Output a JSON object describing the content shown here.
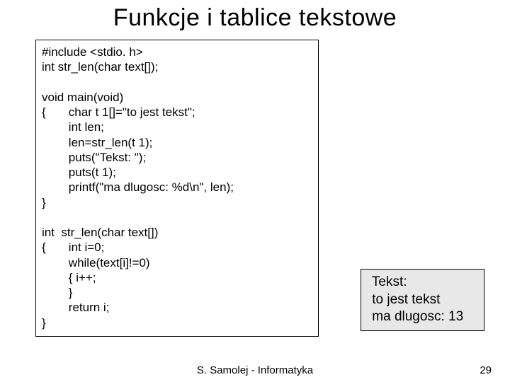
{
  "title": "Funkcje i tablice tekstowe",
  "code": "#include <stdio. h>\nint str_len(char text[]);\n\nvoid main(void)\n{\tchar t 1[]=\"to jest tekst\";\n\tint len;\n\tlen=str_len(t 1);\n\tputs(\"Tekst: \");\n\tputs(t 1);\n\tprintf(\"ma dlugosc: %d\\n\", len);\n}\n\nint  str_len(char text[])\n{\tint i=0;\n\twhile(text[i]!=0)\n\t{ i++;\n\t}\n\treturn i;\n}",
  "output": " Tekst:\n to jest tekst\n ma dlugosc: 13",
  "footer": "S. Samolej - Informatyka",
  "page": "29"
}
